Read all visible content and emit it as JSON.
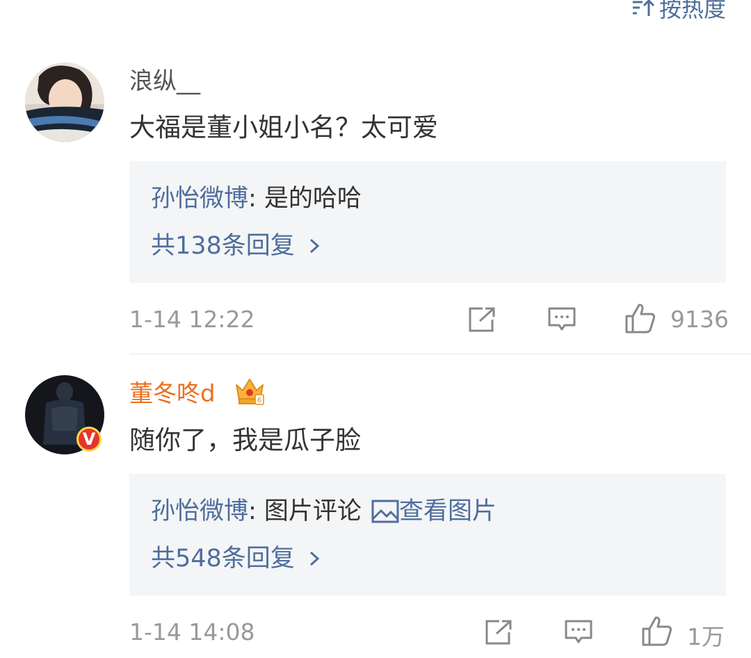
{
  "header": {
    "sort_label": "按热度"
  },
  "comments": [
    {
      "username": "浪纵__",
      "content": "大福是董小姐小名？太可爱",
      "reply": {
        "author": "孙怡微博",
        "text": ": 是的哈哈",
        "more": "共138条回复"
      },
      "time": "1-14 12:22",
      "likes": "9136"
    },
    {
      "username": "董冬咚d",
      "content": "随你了，我是瓜子脸",
      "reply": {
        "author": "孙怡微博",
        "text": ": 图片评论",
        "link": "查看图片",
        "more": "共548条回复"
      },
      "time": "1-14 14:08",
      "likes": "1万",
      "verified_badge": "V"
    }
  ],
  "colors": {
    "link": "#4e6e9c",
    "vip_name": "#ec6f1e",
    "meta": "#999999",
    "reply_bg": "#f4f5f7"
  }
}
